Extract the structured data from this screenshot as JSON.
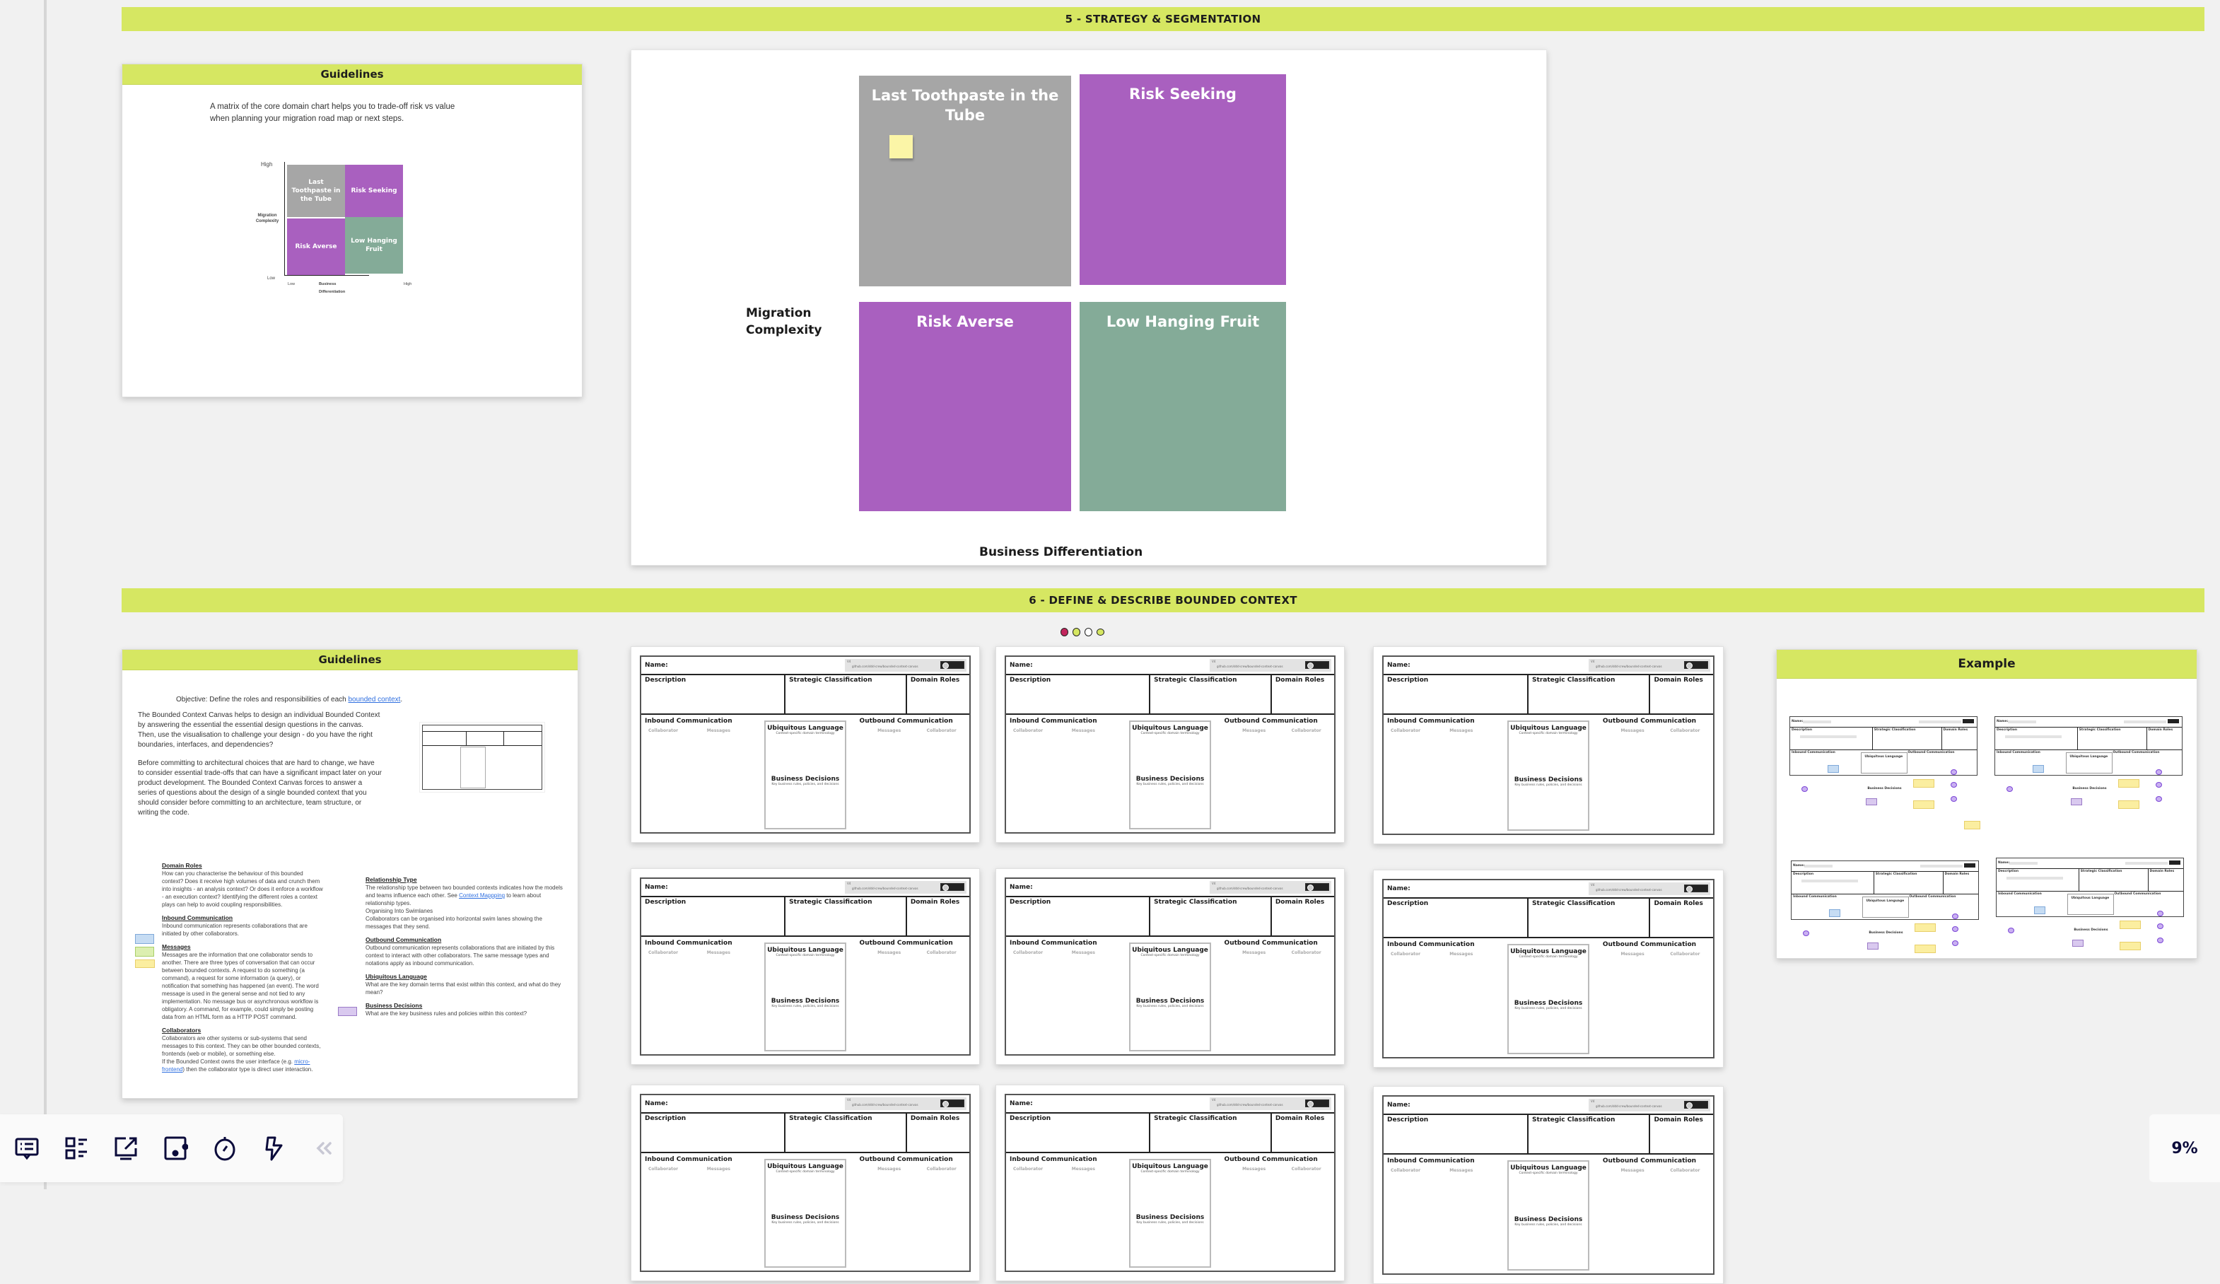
{
  "sections": {
    "s5_title": "5 - STRATEGY & SEGMENTATION",
    "s6_title": "6 - DEFINE & DESCRIBE BOUNDED CONTEXT"
  },
  "guidelines5": {
    "header": "Guidelines",
    "text": "A matrix of the core domain chart helps you to trade-off risk vs value when planning your migration road map or next steps.",
    "mini_matrix": {
      "y_high": "High",
      "y_low": "Low",
      "y_label": "Migration Complexity",
      "x_low": "Low",
      "x_high": "High",
      "x_label": "Business Differentiation",
      "quadrants": [
        "Last Toothpaste in the Tube",
        "Risk Seeking",
        "Risk Averse",
        "Low Hanging Fruit"
      ]
    }
  },
  "matrix": {
    "y_label": "Migration Complexity",
    "x_label": "Business Differentiation",
    "quadrants": [
      {
        "label": "Last Toothpaste in the Tube",
        "color": "#a6a6a6"
      },
      {
        "label": "Risk Seeking",
        "color": "#a960bf"
      },
      {
        "label": "Risk Averse",
        "color": "#a960bf"
      },
      {
        "label": "Low Hanging Fruit",
        "color": "#84ab98"
      }
    ]
  },
  "guidelines6": {
    "header": "Guidelines",
    "objective_prefix": "Objective: Define the roles and responsibilities of each ",
    "objective_link": "bounded context",
    "objective_suffix": ".",
    "para1": "The Bounded Context Canvas helps to design an individual Bounded Context by answering the essential the essential design questions in the canvas. Then, use the visualisation to challenge your design - do you have the right boundaries, interfaces, and dependencies?",
    "para2": "Before committing to architectural choices that are hard to change, we have to consider essential trade-offs that can have a significant impact later on your product development. The Bounded Context Canvas forces to answer a series of questions about the design of a single bounded context that you should consider before committing to an architecture, team structure, or writing the code.",
    "left_items": [
      {
        "title": "Domain Roles",
        "body": "How can you characterise the behaviour of this bounded context? Does it receive high volumes of data and crunch them into insights - an analysis context? Or does it enforce a workflow - an execution context? Identifying the different roles a context plays can help to avoid coupling responsibilities."
      },
      {
        "title": "Inbound Communication",
        "body": "Inbound communication represents collaborations that are initiated by other collaborators."
      },
      {
        "title": "Messages",
        "body": "Messages are the information that one collaborator sends to another. There are three types of conversation that can occur between bounded contexts. A request to do something (a command), a request for some information (a query), or notification that something has happened (an event). The word message is used in the general sense and not tied to any implementation. No message bus or asynchronous workflow is obligatory. A command, for example, could simply be posting data from an HTML form as a HTTP POST command."
      },
      {
        "title": "Collaborators",
        "body": "Collaborators are other systems or sub-systems that send messages to this context. They can be other bounded contexts, frontends (web or mobile), or something else.",
        "body2_prefix": "If the Bounded Context owns the user interface (e.g. ",
        "body2_link": "micro-frontend",
        "body2_suffix": ") then the collaborator type is direct user interaction."
      }
    ],
    "right_items": [
      {
        "title": "Relationship Type",
        "body_prefix": "The relationship type between two bounded contexts indicates how the models and teams influence each other. See ",
        "body_link": "Context Mappping",
        "body_suffix": " to learn about relationship types.",
        "extra1": "Organising Into Swimlanes",
        "extra2": "Collaborators can be organised into horizontal swim lanes showing the messages that they send."
      },
      {
        "title": "Outbound Communication",
        "body": "Outbound communication represents collaborations that are initiated by this context to interact with other collaborators. The same message types and notations apply as inbound communication."
      },
      {
        "title": "Ubiquitous Language",
        "body": "What are the key domain terms that exist within this context, and what do they mean?"
      },
      {
        "title": "Business Decisions",
        "body": "What are the key business rules and policies within this context?"
      }
    ]
  },
  "canvas_template": {
    "name": "Name:",
    "version": "V4",
    "url": "github.com/ddd-crew/bounded-context-canvas",
    "description": "Description",
    "strategic": "Strategic Classification",
    "roles": "Domain Roles",
    "inbound": "Inbound Communication",
    "outbound": "Outbound Communication",
    "collaborator": "Collaborator",
    "messages": "Messages",
    "ul_title": "Ubiquitous Language",
    "ul_sub": "Context-specific domain terminology",
    "bd_title": "Business Decisions",
    "bd_sub": "Key business rules, policies, and decisions"
  },
  "example": {
    "header": "Example",
    "canvas_labels": {
      "name": "Name:",
      "description": "Description",
      "strategic": "Strategic Classification",
      "roles": "Domain Roles",
      "inbound": "Inbound Communication",
      "outbound": "Outbound Communication",
      "ul": "Ubiquitous Language",
      "bd": "Business Decisions"
    }
  },
  "toolbar": {
    "items": [
      "comments-icon",
      "board-list-icon",
      "share-screen-icon",
      "frames-icon",
      "timer-icon",
      "lightning-icon",
      "collapse-icon"
    ]
  },
  "zoom": {
    "level": "9%"
  }
}
